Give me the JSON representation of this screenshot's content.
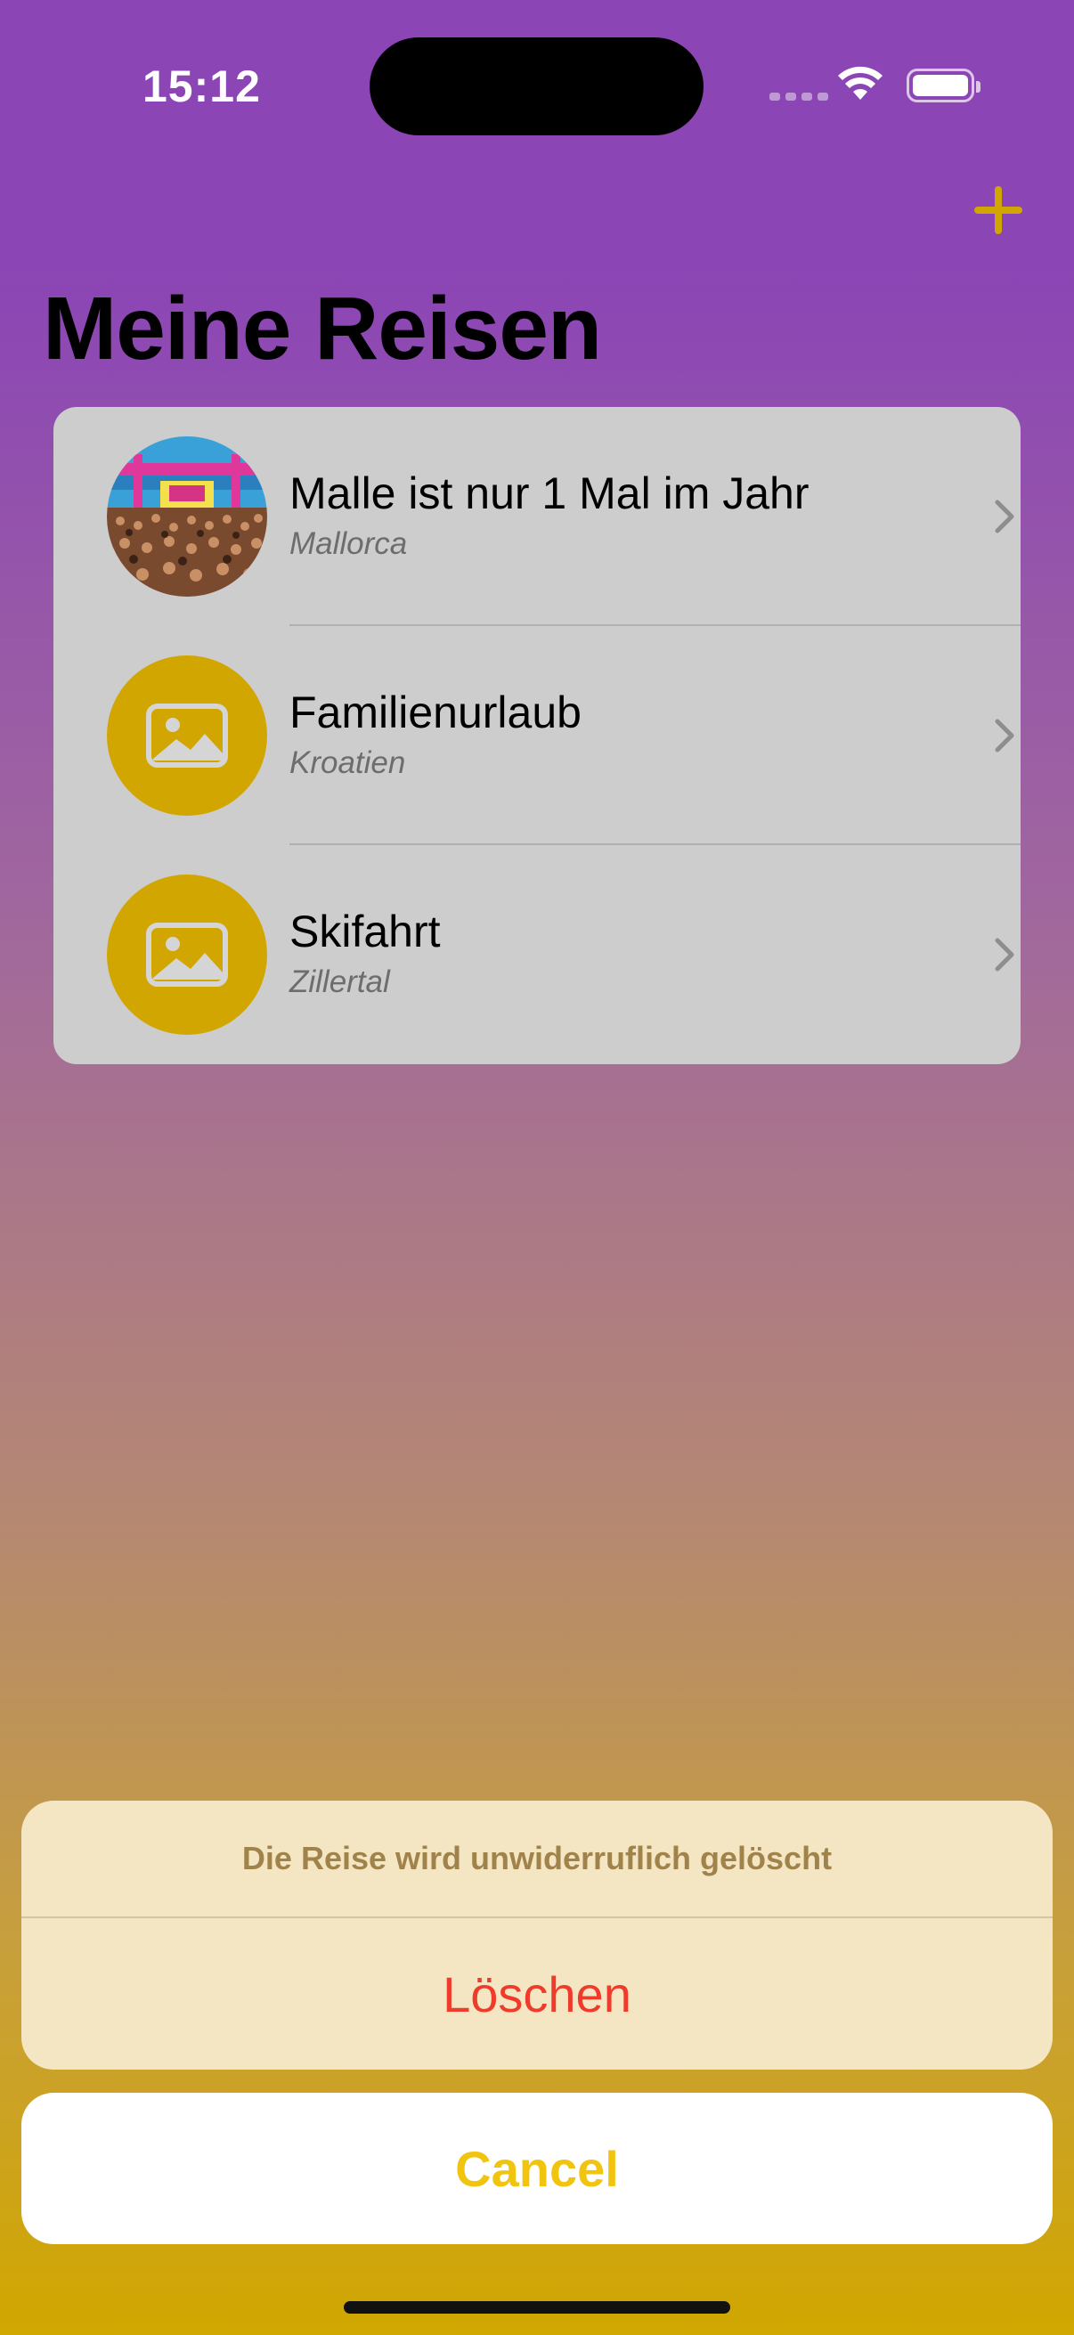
{
  "status_bar": {
    "time": "15:12"
  },
  "nav": {
    "title": "Meine Reisen",
    "add_icon": "plus-icon",
    "accent": "#d2a600"
  },
  "trips": [
    {
      "name": "Malle ist nur 1 Mal im Jahr",
      "location": "Mallorca",
      "image": "party-crowd-photo"
    },
    {
      "name": "Familienurlaub",
      "location": "Kroatien",
      "image": "photo-placeholder-icon"
    },
    {
      "name": "Skifahrt",
      "location": "Zillertal",
      "image": "photo-placeholder-icon"
    }
  ],
  "action_sheet": {
    "message": "Die Reise wird unwiderruflich gelöscht",
    "delete_label": "Löschen",
    "cancel_label": "Cancel"
  },
  "colors": {
    "destructive": "#ef3b2c",
    "cancel": "#f1c40f",
    "gradient_top": "#8b45b5",
    "gradient_bottom": "#d1a700"
  }
}
